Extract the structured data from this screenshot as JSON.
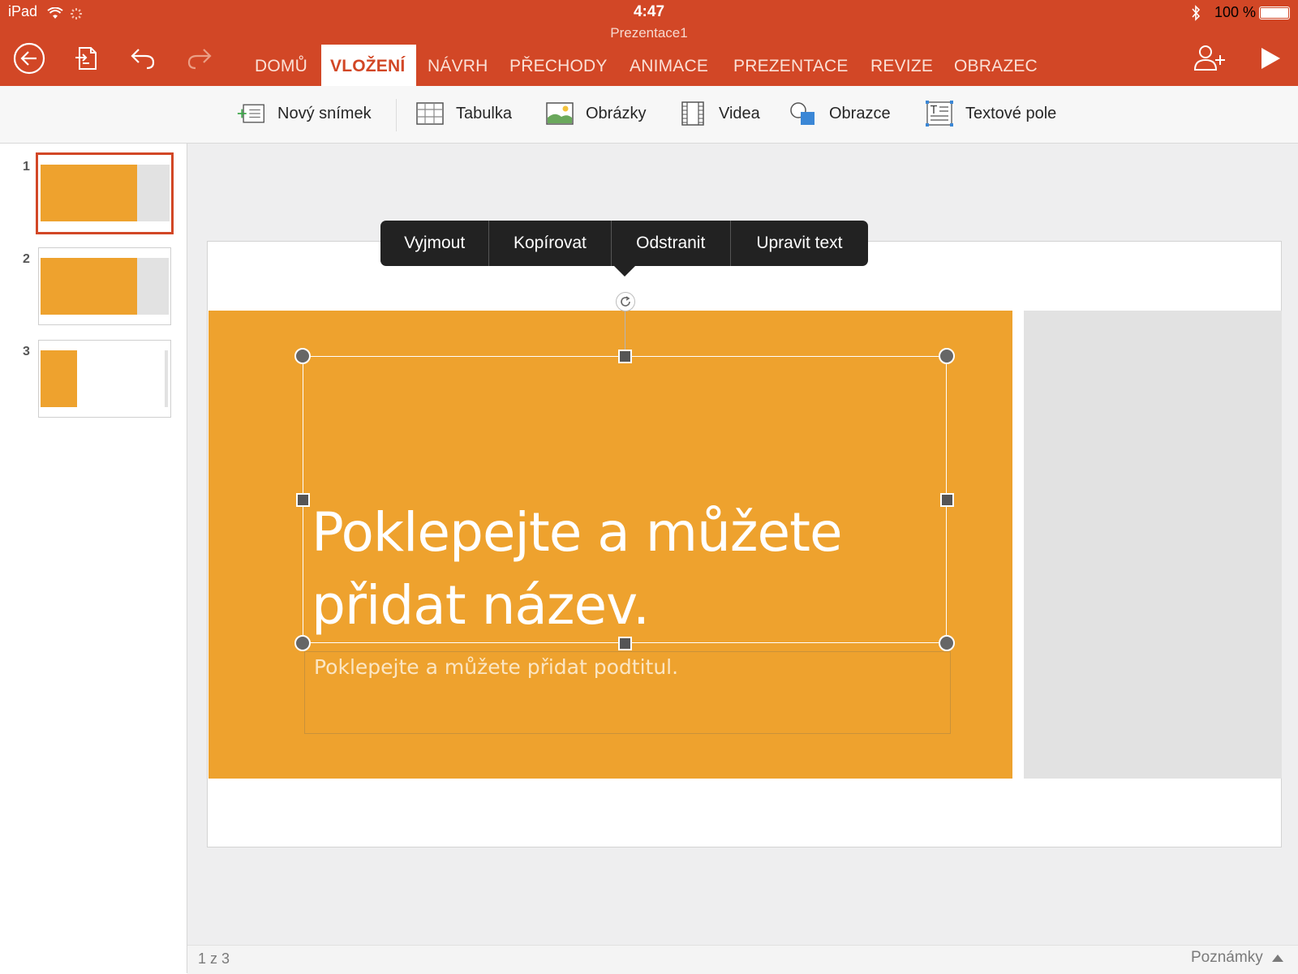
{
  "status_bar": {
    "carrier": "iPad",
    "time": "4:47",
    "battery": "100 %"
  },
  "document": {
    "title": "Prezentace1"
  },
  "toolbar": {
    "back_icon": "back-circle-arrow-icon",
    "file_icon": "file-switch-icon",
    "undo_icon": "undo-icon",
    "redo_icon": "redo-icon",
    "share_icon": "add-person-icon",
    "play_icon": "play-icon"
  },
  "tabs": [
    {
      "label": "DOMŮ"
    },
    {
      "label": "VLOŽENÍ",
      "active": true
    },
    {
      "label": "NÁVRH"
    },
    {
      "label": "PŘECHODY"
    },
    {
      "label": "ANIMACE"
    },
    {
      "label": "PREZENTACE"
    },
    {
      "label": "REVIZE"
    },
    {
      "label": "OBRAZEC"
    }
  ],
  "ribbon": [
    {
      "label": "Nový snímek",
      "icon": "new-slide-icon"
    },
    {
      "label": "Tabulka",
      "icon": "table-icon"
    },
    {
      "label": "Obrázky",
      "icon": "picture-icon"
    },
    {
      "label": "Videa",
      "icon": "video-film-icon"
    },
    {
      "label": "Obrazce",
      "icon": "shapes-icon"
    },
    {
      "label": "Textové pole",
      "icon": "text-box-icon"
    }
  ],
  "thumbnails": [
    {
      "number": "1",
      "selected": true
    },
    {
      "number": "2"
    },
    {
      "number": "3"
    }
  ],
  "context_menu": [
    "Vyjmout",
    "Kopírovat",
    "Odstranit",
    "Upravit text"
  ],
  "slide": {
    "title_placeholder": "Poklepejte a můžete přidat název.",
    "subtitle_placeholder": "Poklepejte a můžete přidat podtitul."
  },
  "footer": {
    "slide_counter": "1 z 3",
    "notes_label": "Poznámky"
  },
  "colors": {
    "accent": "#d24726",
    "slide_orange": "#eea22e",
    "slide_grey": "#e2e2e2"
  }
}
